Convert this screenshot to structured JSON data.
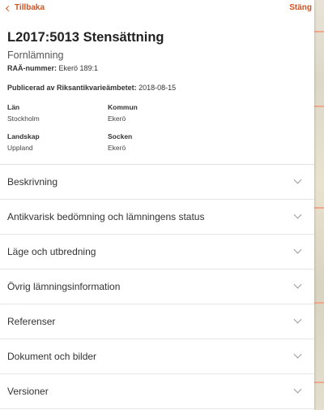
{
  "nav": {
    "back_label": "Tillbaka",
    "close_label": "Stäng"
  },
  "record": {
    "title": "L2017:5013 Stensättning",
    "type": "Fornlämning",
    "raa_label": "RAÄ-nummer:",
    "raa_value": "Ekerö 189:1",
    "published_label": "Publicerad av Riksantikvarieämbetet:",
    "published_value": "2018-08-15"
  },
  "facts": [
    {
      "label": "Län",
      "value": "Stockholm"
    },
    {
      "label": "Kommun",
      "value": "Ekerö"
    },
    {
      "label": "Landskap",
      "value": "Uppland"
    },
    {
      "label": "Socken",
      "value": "Ekerö"
    }
  ],
  "sections": [
    {
      "label": "Beskrivning"
    },
    {
      "label": "Antikvarisk bedömning och lämningens status"
    },
    {
      "label": "Läge och utbredning"
    },
    {
      "label": "Övrig lämningsinformation"
    },
    {
      "label": "Referenser"
    },
    {
      "label": "Dokument och bilder"
    },
    {
      "label": "Versioner"
    }
  ],
  "colors": {
    "accent": "#d2531f",
    "text": "#333333"
  },
  "icons": {
    "back": "chevron-left-icon",
    "section": "chevron-down-icon"
  }
}
